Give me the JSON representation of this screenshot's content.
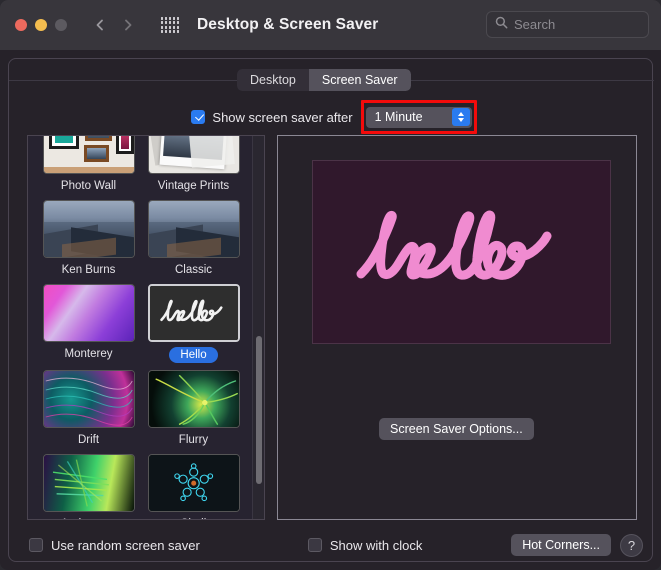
{
  "window": {
    "title": "Desktop & Screen Saver",
    "traffic_lights": [
      "close",
      "minimize",
      "zoom"
    ],
    "nav_back": "back-chevron",
    "nav_forward": "forward-chevron",
    "grid_button": "show-all-preferences"
  },
  "search": {
    "placeholder": "Search",
    "value": ""
  },
  "tabs": [
    {
      "label": "Desktop",
      "active": false
    },
    {
      "label": "Screen Saver",
      "active": true
    }
  ],
  "show_after": {
    "checkbox_label": "Show screen saver after",
    "checked": true,
    "selected_value": "1 Minute",
    "highlight_color": "#f30b0b"
  },
  "screen_savers": [
    {
      "name": "Photo Wall",
      "art": "art-photowall",
      "selected": false
    },
    {
      "name": "Vintage Prints",
      "art": "art-vintage",
      "selected": false
    },
    {
      "name": "Ken Burns",
      "art": "art-mountain",
      "selected": false
    },
    {
      "name": "Classic",
      "art": "art-mountain",
      "selected": false
    },
    {
      "name": "Monterey",
      "art": "art-monterey",
      "selected": false
    },
    {
      "name": "Hello",
      "art": "art-hello",
      "selected": true
    },
    {
      "name": "Drift",
      "art": "art-drift",
      "selected": false
    },
    {
      "name": "Flurry",
      "art": "art-flurry",
      "selected": false
    },
    {
      "name": "Arabesque",
      "art": "art-arabesque",
      "selected": false
    },
    {
      "name": "Shell",
      "art": "art-shell",
      "selected": false
    }
  ],
  "preview": {
    "word": "hello",
    "background_color": "#30182c",
    "stroke_color": "#f08bd0",
    "options_button": "Screen Saver Options..."
  },
  "bottom": {
    "random_label": "Use random screen saver",
    "random_checked": false,
    "clock_label": "Show with clock",
    "clock_checked": false,
    "hot_corners_label": "Hot Corners...",
    "help_label": "?"
  }
}
